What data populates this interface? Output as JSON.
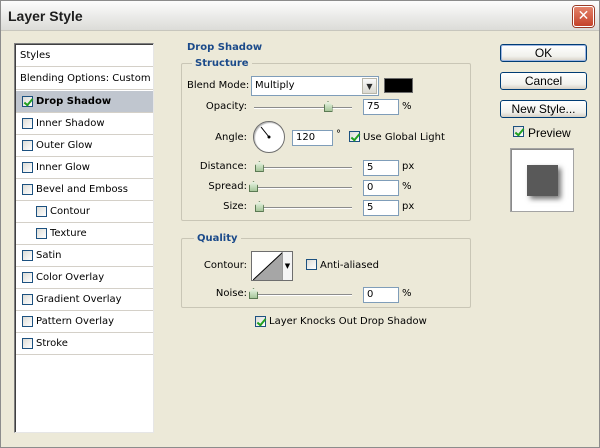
{
  "window": {
    "title": "Layer Style",
    "close_glyph": "✕"
  },
  "sidebar": {
    "header": "Styles",
    "blending": "Blending Options: Custom",
    "items": [
      {
        "label": "Drop Shadow",
        "checked": true,
        "selected": true
      },
      {
        "label": "Inner Shadow",
        "checked": false
      },
      {
        "label": "Outer Glow",
        "checked": false
      },
      {
        "label": "Inner Glow",
        "checked": false
      },
      {
        "label": "Bevel and Emboss",
        "checked": false
      },
      {
        "label": "Contour",
        "checked": false,
        "indent": true
      },
      {
        "label": "Texture",
        "checked": false,
        "indent": true
      },
      {
        "label": "Satin",
        "checked": false
      },
      {
        "label": "Color Overlay",
        "checked": false
      },
      {
        "label": "Gradient Overlay",
        "checked": false
      },
      {
        "label": "Pattern Overlay",
        "checked": false
      },
      {
        "label": "Stroke",
        "checked": false
      }
    ]
  },
  "panel": {
    "title": "Drop Shadow",
    "structure": {
      "legend": "Structure",
      "blend_mode_label": "Blend Mode:",
      "blend_mode_value": "Multiply",
      "blend_color": "#000000",
      "opacity_label": "Opacity:",
      "opacity_value": "75",
      "opacity_unit": "%",
      "opacity_level": 0.75,
      "angle_label": "Angle:",
      "angle_value": "120",
      "angle_unit": "°",
      "global_light_label": "Use Global Light",
      "global_light_checked": true,
      "distance_label": "Distance:",
      "distance_value": "5",
      "distance_unit": "px",
      "distance_level": 0.02,
      "spread_label": "Spread:",
      "spread_value": "0",
      "spread_unit": "%",
      "spread_level": 0.0,
      "size_label": "Size:",
      "size_value": "5",
      "size_unit": "px",
      "size_level": 0.02
    },
    "quality": {
      "legend": "Quality",
      "contour_label": "Contour:",
      "antialiased_label": "Anti-aliased",
      "antialiased_checked": false,
      "noise_label": "Noise:",
      "noise_value": "0",
      "noise_unit": "%",
      "noise_level": 0.0
    },
    "knockout_label": "Layer Knocks Out Drop Shadow",
    "knockout_checked": true
  },
  "buttons": {
    "ok": "OK",
    "cancel": "Cancel",
    "new_style": "New Style...",
    "preview_label": "Preview",
    "preview_checked": true
  }
}
